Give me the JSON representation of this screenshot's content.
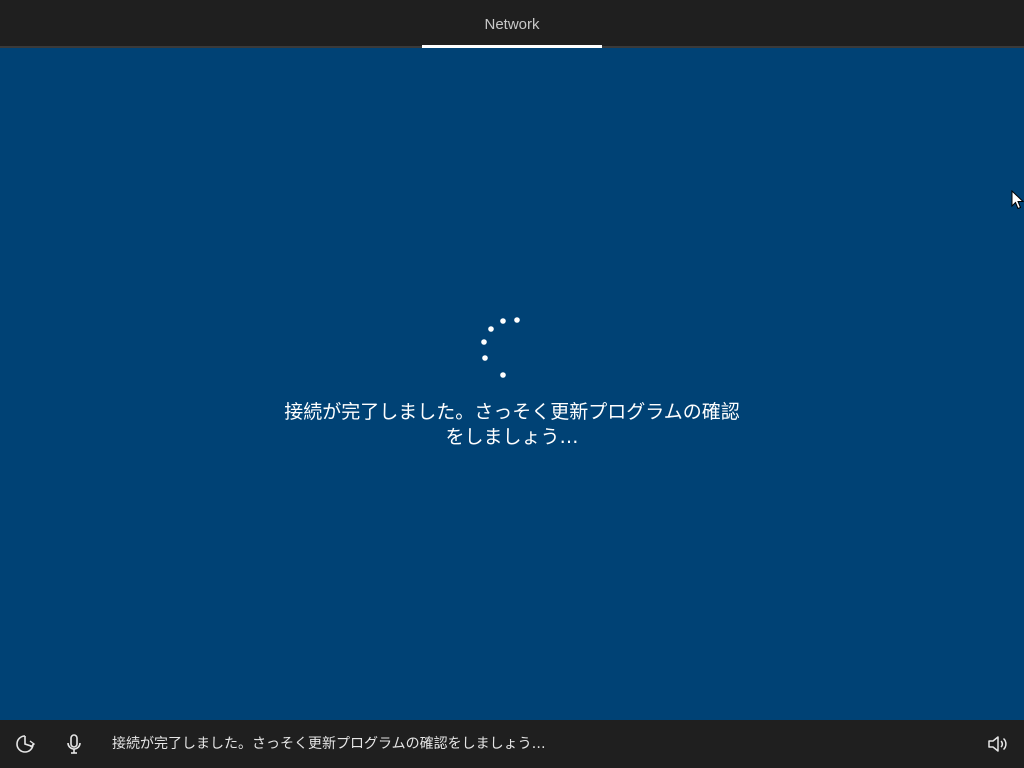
{
  "tabs": [
    {
      "label": "Network",
      "active": true
    }
  ],
  "status": {
    "line1": "接続が完了しました。さっそく更新プログラムの確認",
    "line2": "をしましょう…"
  },
  "bottom_bar": {
    "caption": "接続が完了しました。さっそく更新プログラムの確認をしましょう…",
    "icons": [
      "accessibility-icon",
      "microphone-icon",
      "volume-icon"
    ]
  },
  "colors": {
    "background": "#004275",
    "bars": "#1f1f1f",
    "text": "#ffffff"
  }
}
